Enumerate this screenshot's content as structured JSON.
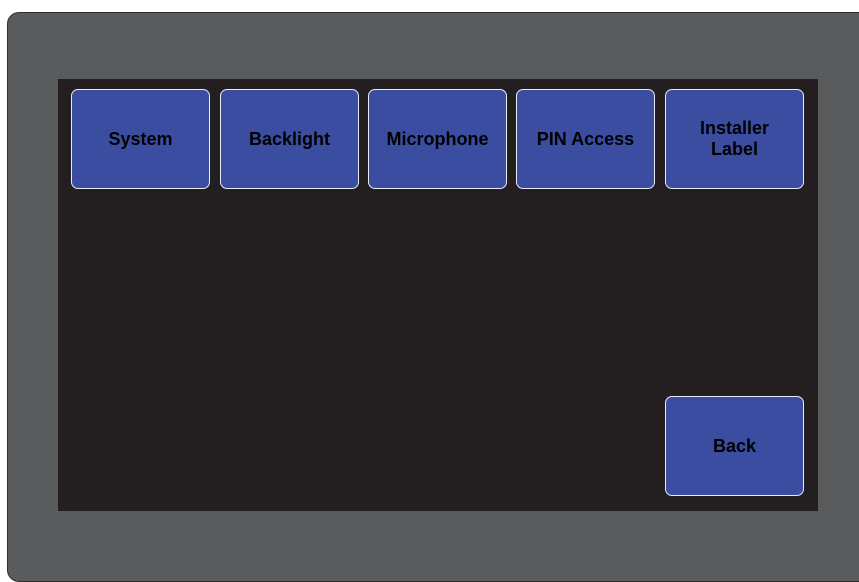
{
  "menu": {
    "buttons": [
      {
        "label": "System"
      },
      {
        "label": "Backlight"
      },
      {
        "label": "Microphone"
      },
      {
        "label": "PIN Access"
      },
      {
        "label": "Installer Label"
      }
    ],
    "back_label": "Back"
  },
  "colors": {
    "bezel": "#5a5b5c",
    "screen": "#231f20",
    "button_fill": "#3a4da0",
    "button_border": "#e9ebf5",
    "button_text": "#000000"
  }
}
